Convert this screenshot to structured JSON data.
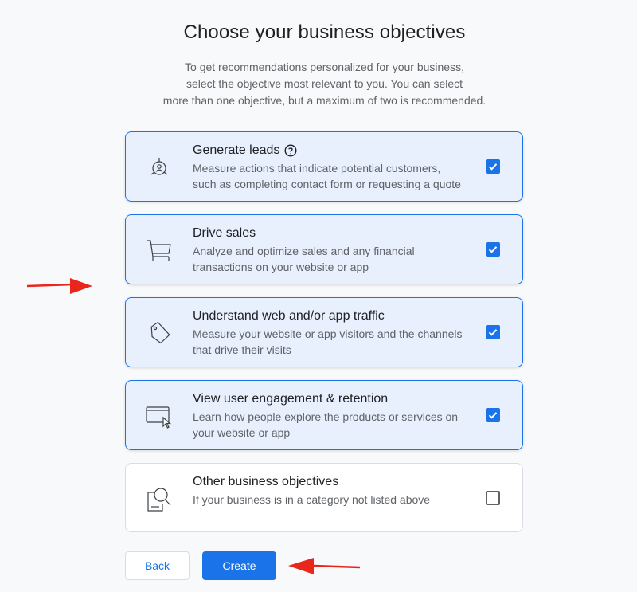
{
  "header": {
    "title": "Choose your business objectives",
    "intro_line1": "To get recommendations personalized for your business,",
    "intro_line2": "select the objective most relevant to you. You can select",
    "intro_line3": "more than one objective, but a maximum of two is recommended."
  },
  "objectives": [
    {
      "title": "Generate leads",
      "desc_line1": "Measure actions that indicate potential customers,",
      "desc_line2": "such as completing contact form or requesting a quote",
      "icon": "target-person-icon",
      "checked": true,
      "has_help": true
    },
    {
      "title": "Drive sales",
      "desc_line1": "Analyze and optimize sales and any financial",
      "desc_line2": "transactions on your website or app",
      "icon": "shopping-cart-icon",
      "checked": true
    },
    {
      "title": "Understand web and/or app traffic",
      "desc_line1": "Measure your website or app visitors and the channels",
      "desc_line2": "that drive their visits",
      "icon": "tag-icon",
      "checked": true
    },
    {
      "title": "View user engagement & retention",
      "desc_line1": "Learn how people explore the products or services on",
      "desc_line2": "your website or app",
      "icon": "browser-cursor-icon",
      "checked": true
    },
    {
      "title": "Other business objectives",
      "desc_line1": "If your business is in a category not listed above",
      "desc_line2": "",
      "icon": "document-magnifier-icon",
      "checked": false
    }
  ],
  "actions": {
    "back_label": "Back",
    "create_label": "Create"
  },
  "colors": {
    "accent": "#1a73e8",
    "selected_bg": "#e8f0fe",
    "annotation_arrow": "#e8261c"
  }
}
